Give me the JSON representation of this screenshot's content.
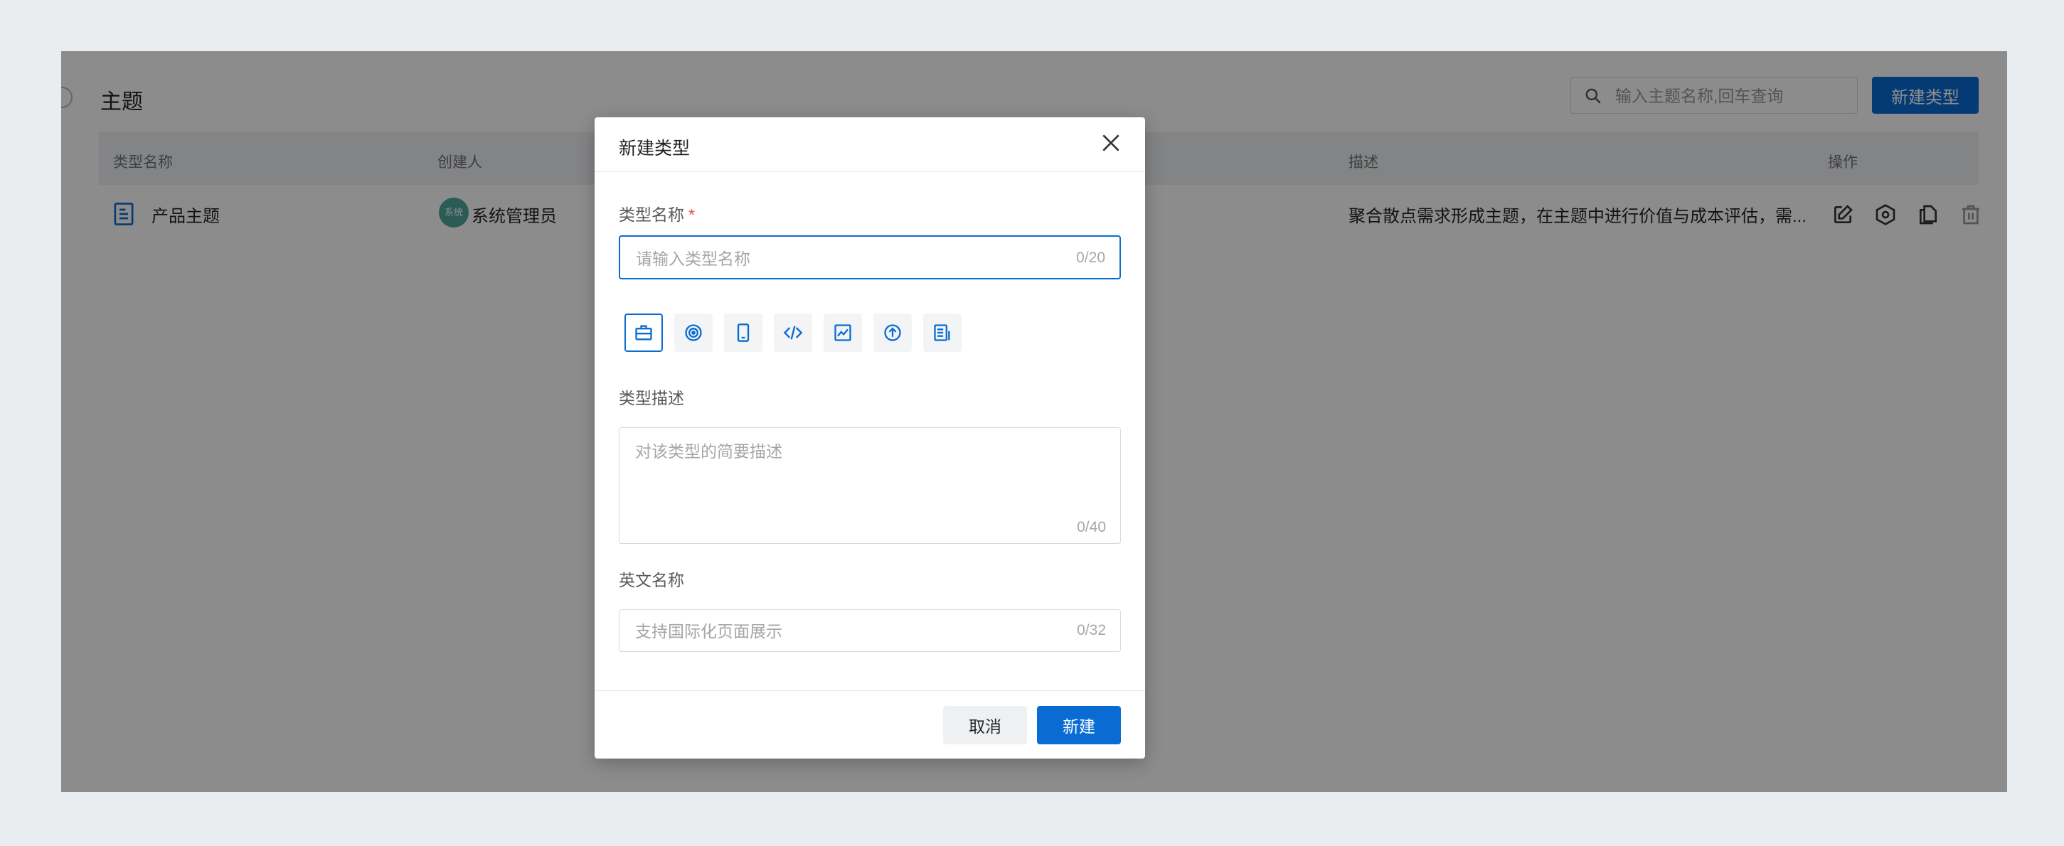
{
  "page": {
    "title": "主题",
    "search_placeholder": "输入主题名称,回车查询",
    "new_type_button": "新建类型"
  },
  "table": {
    "headers": [
      "类型名称",
      "创建人",
      "描述",
      "操作"
    ],
    "rows": [
      {
        "name": "产品主题",
        "avatar_text": "系统",
        "creator": "系统管理员",
        "description": "聚合散点需求形成主题，在主题中进行价值与成本评估，需...",
        "actions": [
          "edit-icon",
          "settings-icon",
          "copy-icon",
          "delete-icon"
        ]
      }
    ]
  },
  "modal": {
    "title": "新建类型",
    "name_label": "类型名称",
    "required_mark": "*",
    "name_placeholder": "请输入类型名称",
    "name_counter": "0/20",
    "icons": [
      "briefcase-icon",
      "target-icon",
      "phone-icon",
      "code-icon",
      "chart-icon",
      "upload-icon",
      "report-icon"
    ],
    "selected_icon": "briefcase-icon",
    "desc_label": "类型描述",
    "desc_placeholder": "对该类型的简要描述",
    "desc_counter": "0/40",
    "en_label": "英文名称",
    "en_placeholder": "支持国际化页面展示",
    "en_counter": "0/32",
    "cancel_label": "取消",
    "create_label": "新建"
  },
  "colors": {
    "primary": "#0a6cd3",
    "background": "#e9edf0",
    "avatar": "#4ea79a",
    "required": "#e34d59"
  }
}
